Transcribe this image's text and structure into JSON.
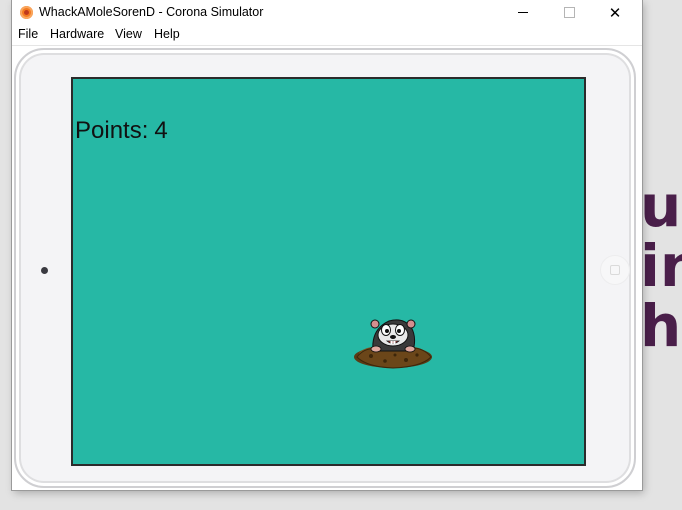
{
  "window": {
    "title": "WhackAMoleSorenD - Corona Simulator",
    "controls": {
      "minimize": "minimize-icon",
      "maximize": "maximize-icon",
      "close": "✕"
    }
  },
  "menu": {
    "items": [
      "File",
      "Hardware",
      "View",
      "Help"
    ]
  },
  "game": {
    "points_label": "Points:",
    "points_value": "4",
    "screen_color": "#26b8a5"
  },
  "background": {
    "letters": [
      "ua",
      "in",
      "hu"
    ]
  }
}
